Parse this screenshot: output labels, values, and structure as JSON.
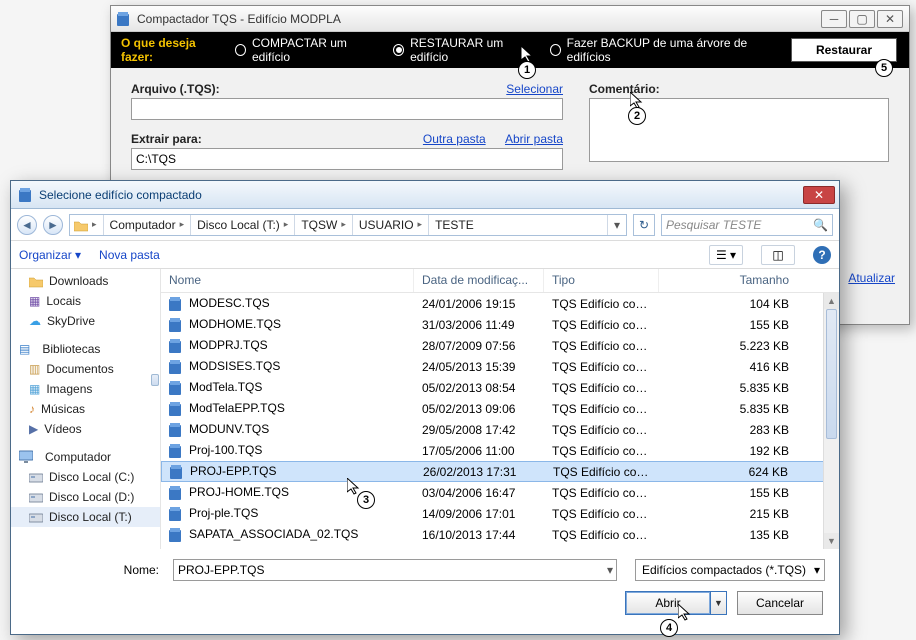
{
  "mainwin": {
    "title": "Compactador TQS - Edifício MODPLA",
    "prompt": "O que deseja fazer:",
    "radios": {
      "compactar": "COMPACTAR um edifício",
      "restaurar": "RESTAURAR um edifício",
      "backup": "Fazer BACKUP de uma árvore de edifícios"
    },
    "restaurar_btn": "Restaurar",
    "arquivo_label": "Arquivo (.TQS):",
    "selecionar": "Selecionar",
    "extrair_label": "Extrair para:",
    "extrair_value": "C:\\TQS",
    "outra_pasta": "Outra pasta",
    "abrir_pasta": "Abrir pasta",
    "comentario_label": "Comentário:",
    "atualizar": "Atualizar"
  },
  "dialog": {
    "title": "Selecione edifício compactado",
    "crumbs": [
      "Computador",
      "Disco Local (T:)",
      "TQSW",
      "USUARIO",
      "TESTE"
    ],
    "search_placeholder": "Pesquisar TESTE",
    "organizarlabel": "Organizar",
    "novapasta": "Nova pasta",
    "nav_items_top": [
      "Downloads",
      "Locais",
      "SkyDrive"
    ],
    "bibliotecas": "Bibliotecas",
    "nav_items_bib": [
      "Documentos",
      "Imagens",
      "Músicas",
      "Vídeos"
    ],
    "computador": "Computador",
    "nav_items_comp": [
      "Disco Local (C:)",
      "Disco Local (D:)",
      "Disco Local (T:)"
    ],
    "headers": {
      "name": "Nome",
      "date": "Data de modificaç...",
      "type": "Tipo",
      "size": "Tamanho"
    },
    "files": [
      {
        "name": "MODESC.TQS",
        "date": "24/01/2006 19:15",
        "type": "TQS Edifício com...",
        "size": "104 KB"
      },
      {
        "name": "MODHOME.TQS",
        "date": "31/03/2006 11:49",
        "type": "TQS Edifício com...",
        "size": "155 KB"
      },
      {
        "name": "MODPRJ.TQS",
        "date": "28/07/2009 07:56",
        "type": "TQS Edifício com...",
        "size": "5.223 KB"
      },
      {
        "name": "MODSISES.TQS",
        "date": "24/05/2013 15:39",
        "type": "TQS Edifício com...",
        "size": "416 KB"
      },
      {
        "name": "ModTela.TQS",
        "date": "05/02/2013 08:54",
        "type": "TQS Edifício com...",
        "size": "5.835 KB"
      },
      {
        "name": "ModTelaEPP.TQS",
        "date": "05/02/2013 09:06",
        "type": "TQS Edifício com...",
        "size": "5.835 KB"
      },
      {
        "name": "MODUNV.TQS",
        "date": "29/05/2008 17:42",
        "type": "TQS Edifício com...",
        "size": "283 KB"
      },
      {
        "name": "Proj-100.TQS",
        "date": "17/05/2006 11:00",
        "type": "TQS Edifício com...",
        "size": "192 KB"
      },
      {
        "name": "PROJ-EPP.TQS",
        "date": "26/02/2013 17:31",
        "type": "TQS Edifício com...",
        "size": "624 KB",
        "selected": true
      },
      {
        "name": "PROJ-HOME.TQS",
        "date": "03/04/2006 16:47",
        "type": "TQS Edifício com...",
        "size": "155 KB"
      },
      {
        "name": "Proj-ple.TQS",
        "date": "14/09/2006 17:01",
        "type": "TQS Edifício com...",
        "size": "215 KB"
      },
      {
        "name": "SAPATA_ASSOCIADA_02.TQS",
        "date": "16/10/2013 17:44",
        "type": "TQS Edifício com...",
        "size": "135 KB"
      }
    ],
    "name_label": "Nome:",
    "name_value": "PROJ-EPP.TQS",
    "filter": "Edifícios compactados (*.TQS)",
    "open_btn": "Abrir",
    "cancel_btn": "Cancelar"
  },
  "callouts": {
    "c1": "1",
    "c2": "2",
    "c3": "3",
    "c4": "4",
    "c5": "5"
  }
}
